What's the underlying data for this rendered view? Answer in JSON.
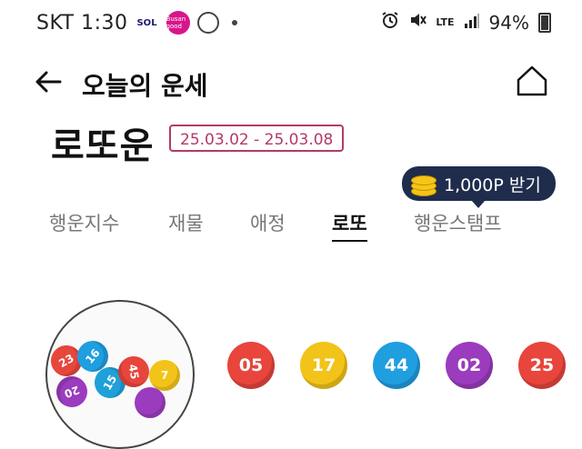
{
  "status_bar": {
    "carrier_time": "SKT 1:30",
    "app_icons": [
      {
        "name": "shinhan-sol-bank-icon",
        "label": "SOL",
        "color": "#1a1a6e"
      },
      {
        "name": "busan-good-icon",
        "label": "Busan good",
        "color": "#d8158b"
      },
      {
        "name": "ring-icon",
        "label": ""
      }
    ],
    "network": "LTE",
    "battery": "94%"
  },
  "header": {
    "title": "오늘의 운세",
    "back_icon": "arrow-left-icon",
    "home_icon": "home-icon"
  },
  "section": {
    "title": "로또운",
    "date_range": "25.03.02 - 25.03.08",
    "accent_color": "#b23a6a"
  },
  "points_tooltip": {
    "label": "1,000P 받기",
    "background": "#1f2c4c"
  },
  "tabs": [
    {
      "label": "행운지수",
      "active": false
    },
    {
      "label": "재물",
      "active": false
    },
    {
      "label": "애정",
      "active": false
    },
    {
      "label": "로또",
      "active": true
    },
    {
      "label": "행운스탬프",
      "active": false
    }
  ],
  "lotto_machine": {
    "balls": [
      {
        "number": "23",
        "color": "#e8453c"
      },
      {
        "number": "16",
        "color": "#1f9ee0"
      },
      {
        "number": "15",
        "color": "#1fa0d8"
      },
      {
        "number": "45",
        "color": "#e8453c"
      },
      {
        "number": "7",
        "color": "#f2c318"
      },
      {
        "number": "20",
        "color": "#9b3bbd"
      },
      {
        "number": "",
        "color": "#9b3bbd"
      }
    ]
  },
  "lucky_numbers": [
    {
      "number": "05",
      "color": "#e8453c"
    },
    {
      "number": "17",
      "color": "#f2c318"
    },
    {
      "number": "44",
      "color": "#1f9ee0"
    },
    {
      "number": "02",
      "color": "#9b3bbd"
    },
    {
      "number": "25",
      "color": "#e8453c"
    }
  ]
}
